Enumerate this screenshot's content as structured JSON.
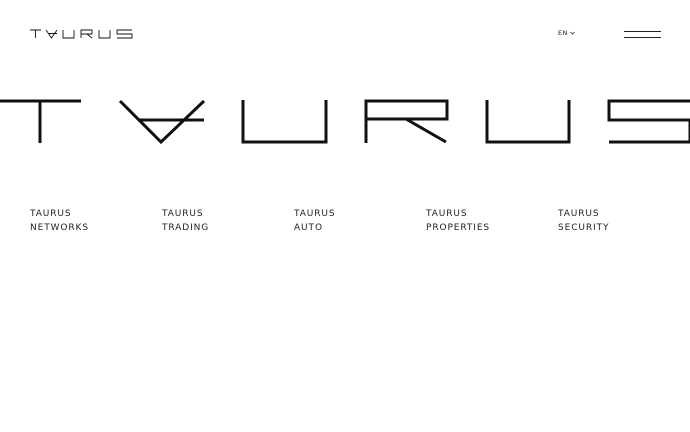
{
  "header": {
    "logo_text": "TAURUS",
    "language": "EN",
    "menu_icon": "hamburger-menu-icon",
    "dropdown_icon": "chevron-down-icon"
  },
  "hero": {
    "logo_text": "TAURUS"
  },
  "brands": [
    {
      "line1": "TAURUS",
      "line2": "NETWORKS"
    },
    {
      "line1": "TAURUS",
      "line2": "TRADING"
    },
    {
      "line1": "TAURUS",
      "line2": "AUTO"
    },
    {
      "line1": "TAURUS",
      "line2": "PROPERTIES"
    },
    {
      "line1": "TAURUS",
      "line2": "SECURITY"
    }
  ]
}
